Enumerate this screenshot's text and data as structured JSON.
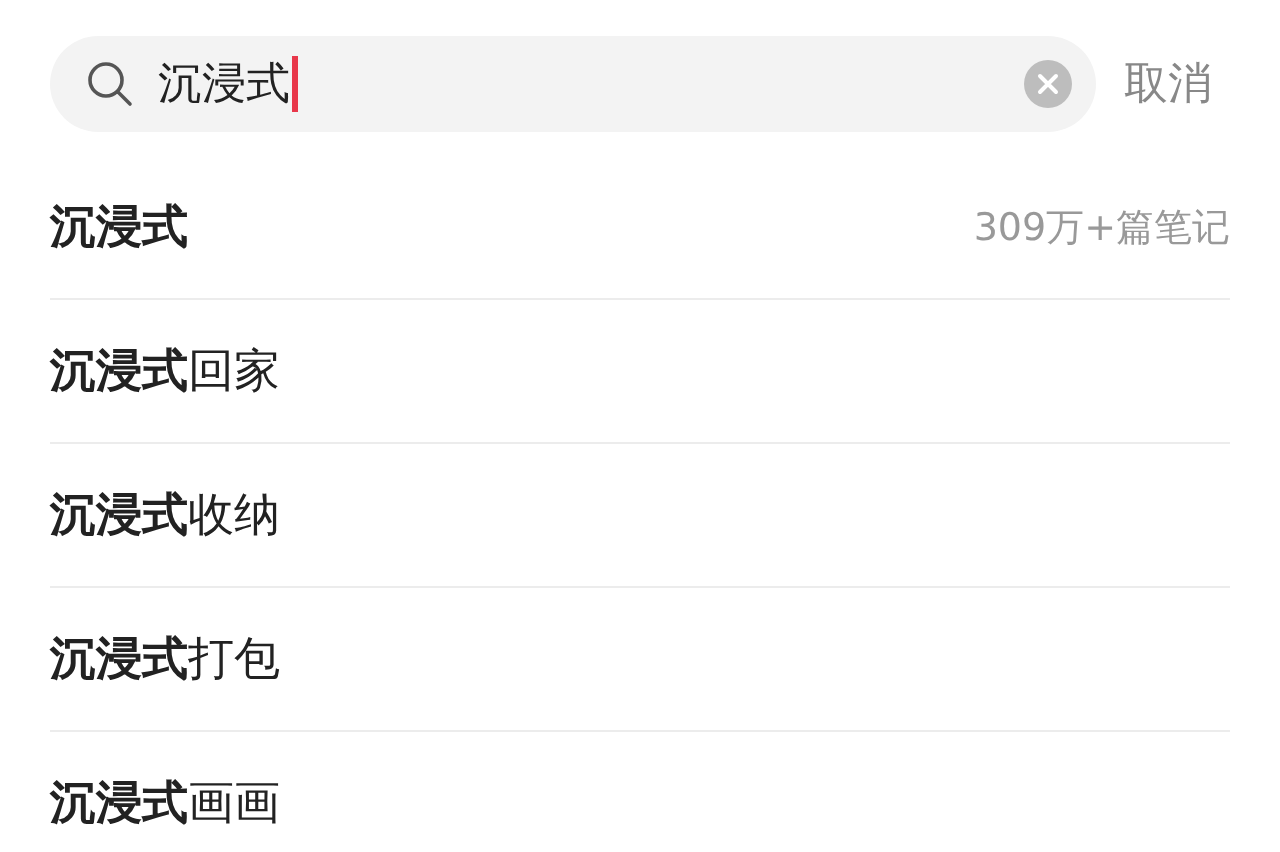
{
  "search": {
    "value": "沉浸式",
    "cancel": "取消"
  },
  "suggestions": [
    {
      "text": "**沉浸式**",
      "count": "309万+篇笔记"
    },
    {
      "text": "**沉浸式**回家"
    },
    {
      "text": "**沉浸式**收纳"
    },
    {
      "text": "**沉浸式**打包"
    },
    {
      "text": "**沉浸式**画画"
    }
  ]
}
